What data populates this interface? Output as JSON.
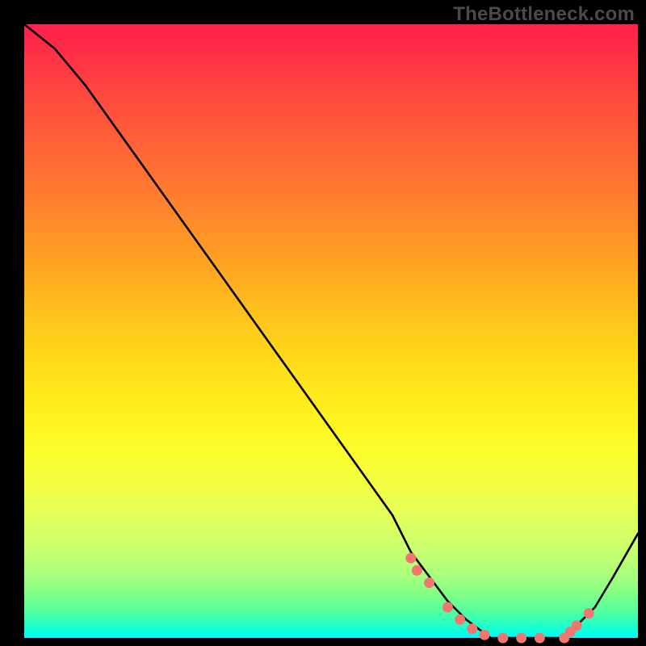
{
  "watermark": "TheBottleneck.com",
  "chart_data": {
    "type": "line",
    "title": "",
    "xlabel": "",
    "ylabel": "",
    "xlim": [
      0,
      100
    ],
    "ylim": [
      0,
      100
    ],
    "series": [
      {
        "name": "bottleneck-curve",
        "x": [
          0,
          5,
          10,
          15,
          20,
          25,
          30,
          35,
          40,
          45,
          50,
          55,
          60,
          63,
          66,
          69,
          72,
          76,
          80,
          84,
          88,
          90,
          93,
          96,
          100
        ],
        "values": [
          100,
          96,
          90,
          83,
          76,
          69,
          62,
          55,
          48,
          41,
          34,
          27,
          20,
          14,
          10,
          6,
          3,
          0,
          0,
          0,
          0,
          2,
          5,
          10,
          17
        ]
      }
    ],
    "markers": {
      "name": "highlight-dots",
      "color": "#f0766f",
      "x": [
        63,
        64,
        66,
        69,
        71,
        73,
        75,
        78,
        81,
        84,
        88,
        89,
        90,
        92
      ],
      "values": [
        13,
        11,
        9,
        5,
        3,
        1.5,
        0.5,
        0,
        0,
        0,
        0,
        1,
        2,
        4
      ]
    }
  }
}
